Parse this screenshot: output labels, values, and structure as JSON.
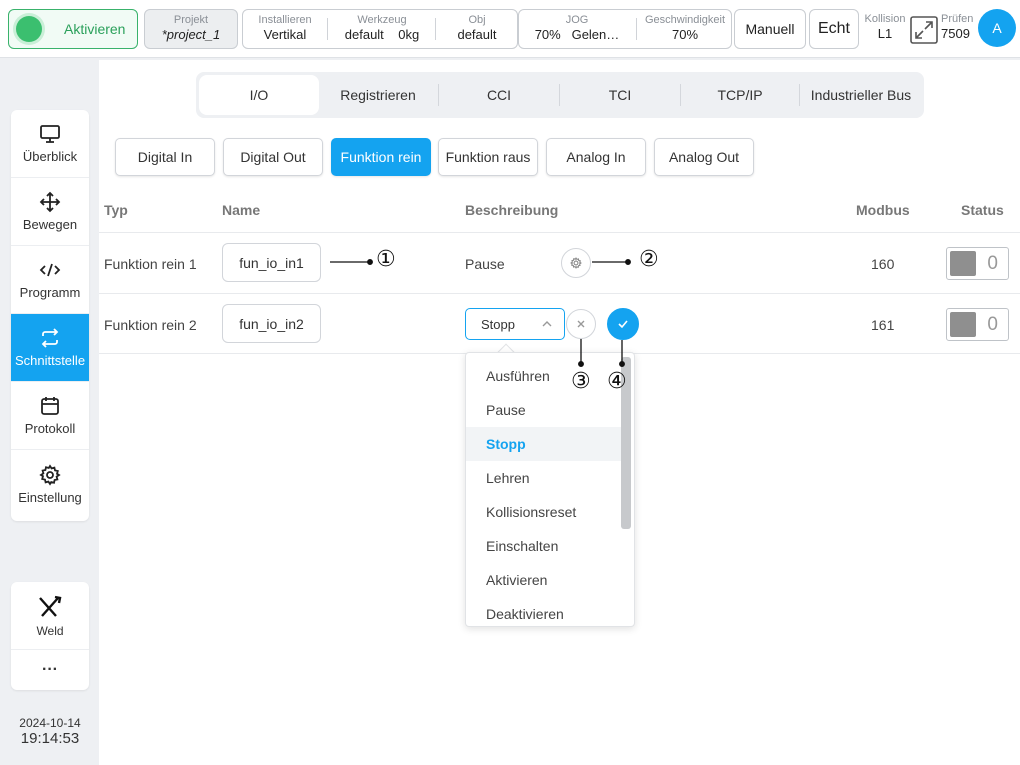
{
  "topbar": {
    "activate_label": "Aktivieren",
    "project": {
      "label": "Projekt",
      "value": "*project_1"
    },
    "install": {
      "label": "Installieren",
      "value": "Vertikal"
    },
    "tool": {
      "label": "Werkzeug",
      "value": "default",
      "payload": "0kg"
    },
    "obj": {
      "label": "Obj",
      "value": "default"
    },
    "jog": {
      "label": "JOG",
      "pct": "70%",
      "mode": "Gelen…"
    },
    "speed": {
      "label": "Geschwindigkeit",
      "value": "70%"
    },
    "manual_label": "Manuell",
    "real_label": "Echt",
    "collision": {
      "label": "Kollision",
      "value": "L1"
    },
    "check": {
      "label": "Prüfen",
      "value": "7509"
    },
    "avatar": "A"
  },
  "sidebar": {
    "items": [
      {
        "label": "Überblick",
        "icon": "monitor-icon"
      },
      {
        "label": "Bewegen",
        "icon": "move-icon"
      },
      {
        "label": "Programm",
        "icon": "code-icon"
      },
      {
        "label": "Schnittstelle",
        "icon": "swap-icon"
      },
      {
        "label": "Protokoll",
        "icon": "calendar-icon"
      },
      {
        "label": "Einstellung",
        "icon": "gear-icon"
      }
    ],
    "active": "Schnittstelle",
    "weld_label": "Weld",
    "more_label": "···",
    "date": "2024-10-14",
    "time": "19:14:53"
  },
  "tabs": [
    "I/O",
    "Registrieren",
    "CCI",
    "TCI",
    "TCP/IP",
    "Industrieller Bus"
  ],
  "active_tab": "I/O",
  "subtabs": [
    "Digital In",
    "Digital Out",
    "Funktion rein",
    "Funktion raus",
    "Analog In",
    "Analog Out"
  ],
  "active_subtab": "Funktion rein",
  "table": {
    "headers": {
      "type": "Typ",
      "name": "Name",
      "desc": "Beschreibung",
      "modbus": "Modbus",
      "status": "Status"
    },
    "rows": [
      {
        "type": "Funktion rein 1",
        "name": "fun_io_in1",
        "desc": "Pause",
        "modbus": "160",
        "status": "0"
      },
      {
        "type": "Funktion rein 2",
        "name": "fun_io_in2",
        "desc": "Stopp",
        "modbus": "161",
        "status": "0"
      }
    ]
  },
  "dropdown": {
    "options": [
      "Ausführen",
      "Pause",
      "Stopp",
      "Lehren",
      "Kollisionsreset",
      "Einschalten",
      "Aktivieren",
      "Deaktivieren"
    ],
    "selected": "Stopp"
  },
  "callouts": [
    "①",
    "②",
    "③",
    "④"
  ],
  "colors": {
    "accent": "#14a3f0",
    "active_green": "#3bbf6f"
  }
}
